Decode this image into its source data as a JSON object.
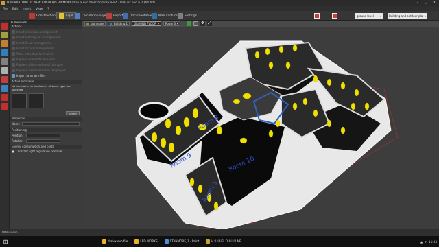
{
  "window": {
    "title": "H:\\UIRIEL DIALUX NEW FOLDER\\STANMORE\\dialux.evo file\\stanmore.evo* - DIALux evo 6.2   (64 bit)",
    "controls": [
      "–",
      "□",
      "✕"
    ]
  },
  "menu": [
    "File",
    "Edit",
    "Insert",
    "View",
    "?"
  ],
  "tabs": [
    {
      "label": "Construction",
      "active": false,
      "icon_color": "#b04030"
    },
    {
      "label": "Light",
      "active": true,
      "icon_color": "#e8c030"
    },
    {
      "label": "Calculation objects",
      "active": false,
      "icon_color": "#5080c0"
    },
    {
      "label": "Export",
      "active": false,
      "icon_color": "#c04040"
    },
    {
      "label": "Documentation",
      "active": false,
      "icon_color": "#4070b0"
    },
    {
      "label": "Manufacturer",
      "active": false,
      "icon_color": "#3070a0"
    },
    {
      "label": "Settings",
      "active": false,
      "icon_color": "#808080"
    }
  ],
  "right_controls": {
    "level_select": "ground level",
    "view_select": "Building and outdoor pla"
  },
  "left_panel": {
    "header": "Luminaires",
    "actions_header": "Actions",
    "actions": [
      {
        "label": "Insert individual arrangement",
        "enabled": false
      },
      {
        "label": "Insert rectangular arrangement",
        "enabled": false
      },
      {
        "label": "Insert linear arrangement",
        "enabled": false
      },
      {
        "label": "Insert circular arrangement",
        "enabled": false
      },
      {
        "label": "Place individual luminaires",
        "enabled": false
      },
      {
        "label": "Replace selected luminaires",
        "enabled": false
      },
      {
        "label": "Replace all luminaires of this type",
        "enabled": false
      },
      {
        "label": "Replace all luminaires in the project",
        "enabled": false
      },
      {
        "label": "Import luminaire file",
        "enabled": true
      }
    ],
    "active_header": "Active luminaire",
    "active_warning": "No luminaires or luminaires of same type are selected",
    "select_button": "Select",
    "properties_header": "Properties",
    "name_label": "Name",
    "positioning_header": "Positioning",
    "position_label": "Position",
    "rotation_label": "Rotation",
    "energy_header": "Energy consumption and costs",
    "constant_light_label": "Constant light regulation possible"
  },
  "viewport_toolbar": {
    "breadcrumbs": [
      "stanmore",
      "Building 1",
      "GROUND FLOOR",
      "Room 3"
    ]
  },
  "rooms": [
    "Room 8",
    "Room 9",
    "Room 10",
    "Room 5"
  ],
  "status": "DIALux evo",
  "taskbar": {
    "items": [
      {
        "label": "dialux evo file",
        "icon_color": "#e8b030"
      },
      {
        "label": "LED WORKS",
        "icon_color": "#e8b030"
      },
      {
        "label": "STANMORE_1 - Paint",
        "icon_color": "#5090d0"
      },
      {
        "label": "H:\\UIRIEL DIALUX NE...",
        "icon_color": "#c8a030"
      }
    ],
    "time": "11:04"
  }
}
